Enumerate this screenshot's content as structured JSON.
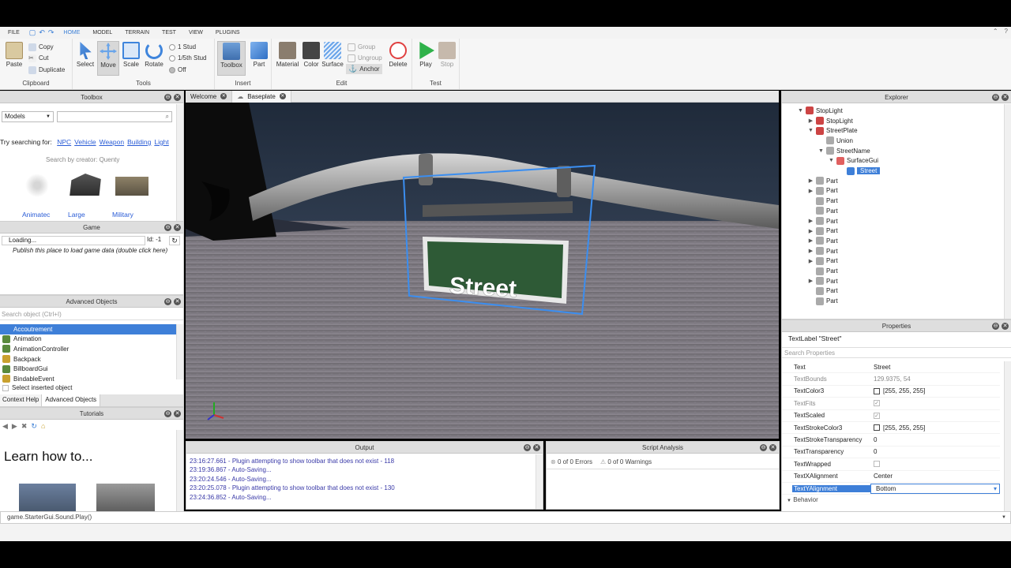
{
  "menu": {
    "file": "FILE",
    "tabs": [
      "HOME",
      "MODEL",
      "TERRAIN",
      "TEST",
      "VIEW",
      "PLUGINS"
    ],
    "active_tab": "HOME"
  },
  "ribbon": {
    "clipboard": {
      "paste": "Paste",
      "copy": "Copy",
      "cut": "Cut",
      "duplicate": "Duplicate",
      "label": "Clipboard"
    },
    "tools": {
      "select": "Select",
      "move": "Move",
      "scale": "Scale",
      "rotate": "Rotate",
      "stud1": "1 Stud",
      "stud5": "1/5th Stud",
      "off": "Off",
      "label": "Tools"
    },
    "insert": {
      "toolbox": "Toolbox",
      "part": "Part",
      "label": "Insert"
    },
    "edit": {
      "material": "Material",
      "color": "Color",
      "surface": "Surface",
      "group": "Group",
      "ungroup": "Ungroup",
      "anchor": "Anchor",
      "delete": "Delete",
      "label": "Edit"
    },
    "test": {
      "play": "Play",
      "stop": "Stop",
      "label": "Test"
    }
  },
  "toolbox": {
    "title": "Toolbox",
    "category": "Models",
    "search_value": "",
    "try_label": "Try searching for:",
    "suggestions": [
      "NPC",
      "Vehicle",
      "Weapon",
      "Building",
      "Light"
    ],
    "creator_line": "Search by creator: Quenty",
    "items": [
      "Animatec",
      "Large",
      "Military"
    ]
  },
  "game": {
    "title": "Game",
    "loading": "Loading...",
    "id_label": "Id: -1",
    "message": "Publish this place to load game data (double click here)"
  },
  "advanced_objects": {
    "title": "Advanced Objects",
    "search_placeholder": "Search object (Ctrl+I)",
    "items": [
      "Accoutrement",
      "Animation",
      "AnimationController",
      "Backpack",
      "BillboardGui",
      "BindableEvent"
    ],
    "selected": "Accoutrement",
    "select_inserted": "Select inserted object",
    "tabs": [
      "Context Help",
      "Advanced Objects"
    ]
  },
  "tutorials": {
    "title": "Tutorials",
    "heading": "Learn how to..."
  },
  "doc_tabs": [
    "Welcome",
    "Baseplate"
  ],
  "viewport": {
    "sign_text": "Street"
  },
  "output": {
    "title": "Output",
    "lines": [
      "23:16:27.661 - Plugin attempting to show toolbar that does not exist - 118",
      "23:19:36.867 - Auto-Saving...",
      "23:20:24.546 - Auto-Saving...",
      "23:20:25.078 - Plugin attempting to show toolbar that does not exist - 130",
      "23:24:36.852 - Auto-Saving..."
    ]
  },
  "script_analysis": {
    "title": "Script Analysis",
    "errors": "0 of 0 Errors",
    "warnings": "0 of 0 Warnings"
  },
  "explorer": {
    "title": "Explorer",
    "rows": [
      {
        "label": "StopLight",
        "tri": "▼",
        "icon": "model"
      },
      {
        "label": "StopLight",
        "tri": "▶",
        "icon": "model"
      },
      {
        "label": "StreetPlate",
        "tri": "▼",
        "icon": "model"
      },
      {
        "label": "Union",
        "tri": "",
        "icon": "part"
      },
      {
        "label": "StreetName",
        "tri": "▼",
        "icon": "part"
      },
      {
        "label": "SurfaceGui",
        "tri": "▼",
        "icon": "gui"
      },
      {
        "label": "Street",
        "tri": "",
        "icon": "text"
      },
      {
        "label": "Part",
        "tri": "▶",
        "icon": "part"
      },
      {
        "label": "Part",
        "tri": "▶",
        "icon": "part"
      },
      {
        "label": "Part",
        "tri": "",
        "icon": "part"
      },
      {
        "label": "Part",
        "tri": "",
        "icon": "part"
      },
      {
        "label": "Part",
        "tri": "▶",
        "icon": "part"
      },
      {
        "label": "Part",
        "tri": "▶",
        "icon": "part"
      },
      {
        "label": "Part",
        "tri": "▶",
        "icon": "part"
      },
      {
        "label": "Part",
        "tri": "▶",
        "icon": "part"
      },
      {
        "label": "Part",
        "tri": "▶",
        "icon": "part"
      },
      {
        "label": "Part",
        "tri": "",
        "icon": "part"
      },
      {
        "label": "Part",
        "tri": "▶",
        "icon": "part"
      },
      {
        "label": "Part",
        "tri": "",
        "icon": "part"
      },
      {
        "label": "Part",
        "tri": "",
        "icon": "part"
      }
    ]
  },
  "properties": {
    "title": "Properties",
    "object": "TextLabel \"Street\"",
    "search_placeholder": "Search Properties",
    "rows": [
      {
        "name": "Text",
        "value": "Street",
        "kind": "text",
        "gray": false
      },
      {
        "name": "TextBounds",
        "value": "129.9375, 54",
        "kind": "text",
        "gray": true
      },
      {
        "name": "TextColor3",
        "value": "[255, 255, 255]",
        "kind": "color",
        "gray": false
      },
      {
        "name": "TextFits",
        "value": "✓",
        "kind": "check",
        "gray": true
      },
      {
        "name": "TextScaled",
        "value": "✓",
        "kind": "check",
        "gray": false
      },
      {
        "name": "TextStrokeColor3",
        "value": "[255, 255, 255]",
        "kind": "color",
        "gray": false
      },
      {
        "name": "TextStrokeTransparency",
        "value": "0",
        "kind": "text",
        "gray": false
      },
      {
        "name": "TextTransparency",
        "value": "0",
        "kind": "text",
        "gray": false
      },
      {
        "name": "TextWrapped",
        "value": "",
        "kind": "check",
        "gray": false
      },
      {
        "name": "TextXAlignment",
        "value": "Center",
        "kind": "text",
        "gray": false
      },
      {
        "name": "TextYAlignment",
        "value": "Bottom",
        "kind": "dropdown",
        "gray": false
      }
    ],
    "section": "Behavior"
  },
  "command_bar": {
    "value": "game.StarterGui.Sound.Play()"
  }
}
